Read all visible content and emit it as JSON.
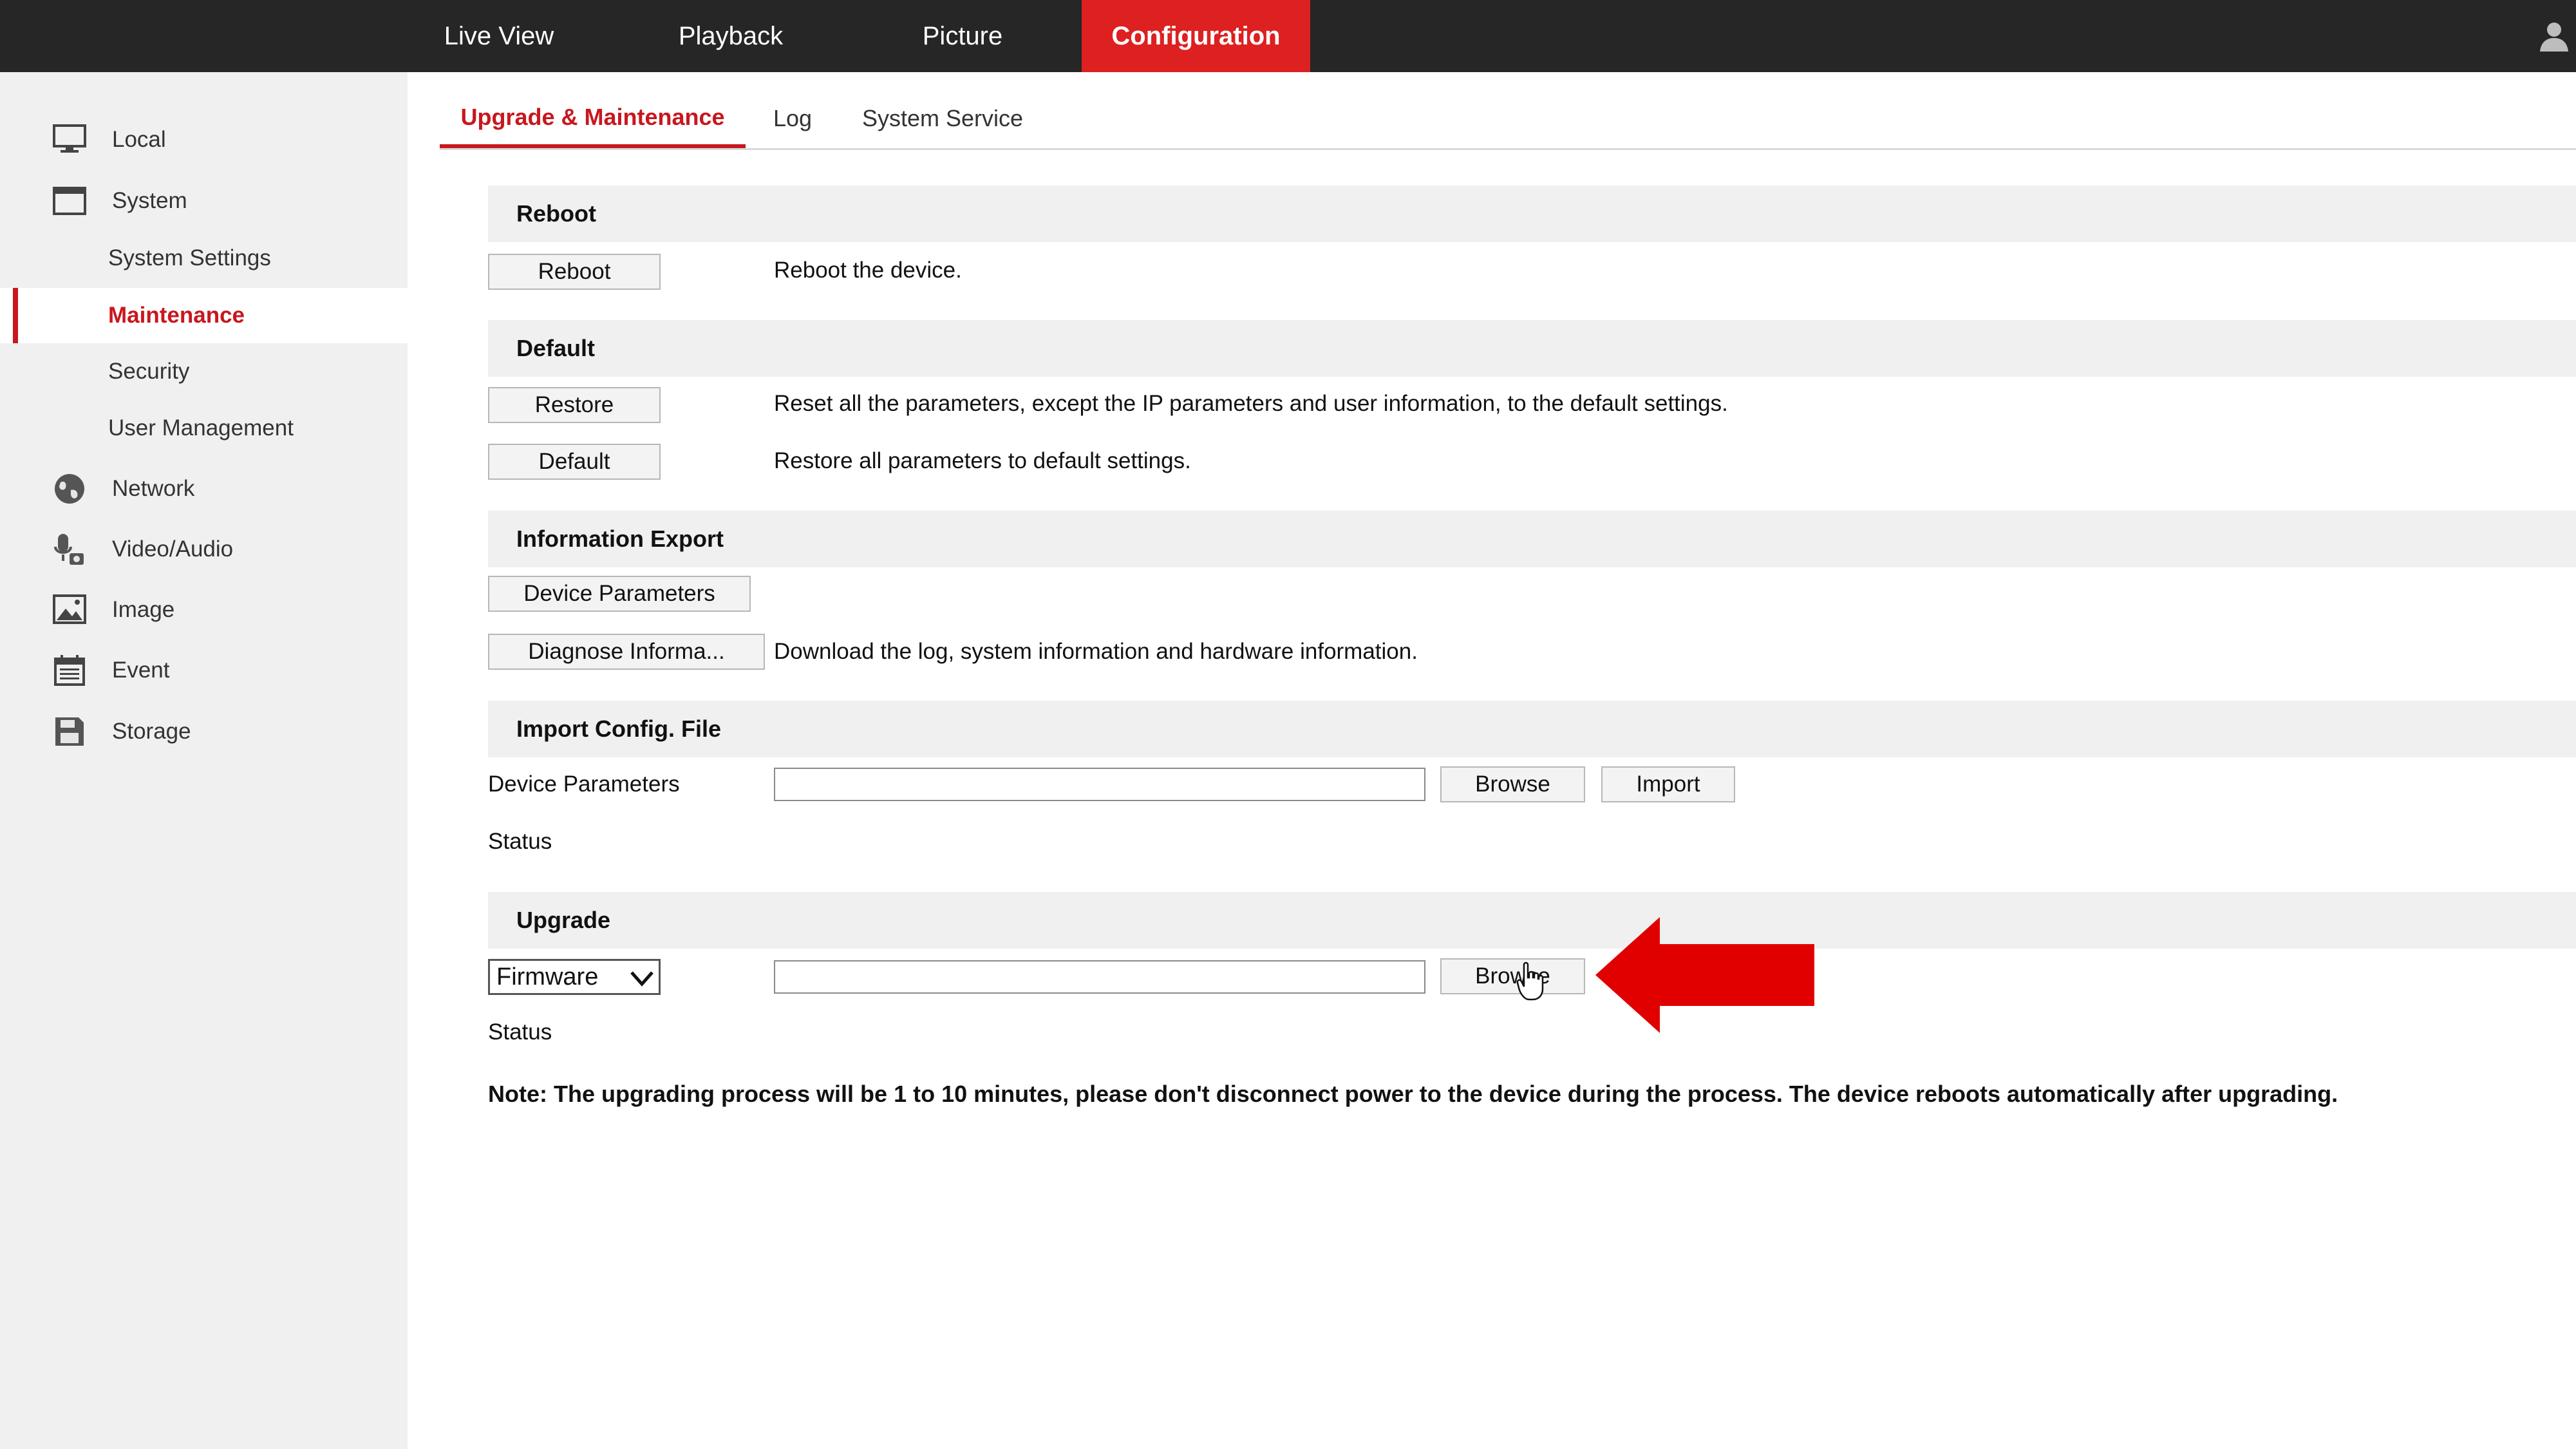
{
  "topnav": {
    "items": [
      {
        "label": "Live View"
      },
      {
        "label": "Playback"
      },
      {
        "label": "Picture"
      },
      {
        "label": "Configuration",
        "active": true
      }
    ]
  },
  "sidebar": {
    "items": [
      {
        "label": "Local",
        "icon": "monitor-icon"
      },
      {
        "label": "System",
        "icon": "system-window-icon"
      },
      {
        "label": "System Settings",
        "sub": true
      },
      {
        "label": "Maintenance",
        "sub": true,
        "active": true
      },
      {
        "label": "Security",
        "sub": true
      },
      {
        "label": "User Management",
        "sub": true
      },
      {
        "label": "Network",
        "icon": "globe-icon"
      },
      {
        "label": "Video/Audio",
        "icon": "microphone-camera-icon"
      },
      {
        "label": "Image",
        "icon": "image-icon"
      },
      {
        "label": "Event",
        "icon": "calendar-icon"
      },
      {
        "label": "Storage",
        "icon": "save-disk-icon"
      }
    ]
  },
  "tabs": [
    {
      "label": "Upgrade & Maintenance",
      "active": true
    },
    {
      "label": "Log"
    },
    {
      "label": "System Service"
    }
  ],
  "reboot": {
    "title": "Reboot",
    "button": "Reboot",
    "desc": "Reboot the device."
  },
  "default": {
    "title": "Default",
    "restore_button": "Restore",
    "restore_desc": "Reset all the parameters, except the IP parameters and user information, to the default settings.",
    "default_button": "Default",
    "default_desc": "Restore all parameters to default settings."
  },
  "export": {
    "title": "Information Export",
    "device_params_button": "Device Parameters",
    "diagnose_button": "Diagnose Informa...",
    "diagnose_desc": "Download the log, system information and hardware information."
  },
  "import_config": {
    "title": "Import Config. File",
    "field_label": "Device Parameters",
    "field_value": "",
    "browse_button": "Browse",
    "import_button": "Import",
    "status_label": "Status"
  },
  "upgrade": {
    "title": "Upgrade",
    "select_value": "Firmware",
    "field_value": "",
    "browse_button": "Browse",
    "status_label": "Status",
    "note": "Note: The upgrading process will be 1 to 10 minutes, please don't disconnect power to the device during the process. The device reboots automatically after upgrading."
  },
  "colors": {
    "accent": "#dd2020",
    "active_text": "#c8171e",
    "topbar": "#262626",
    "sidebar_bg": "#f0f0f0",
    "arrow": "#e00000"
  }
}
